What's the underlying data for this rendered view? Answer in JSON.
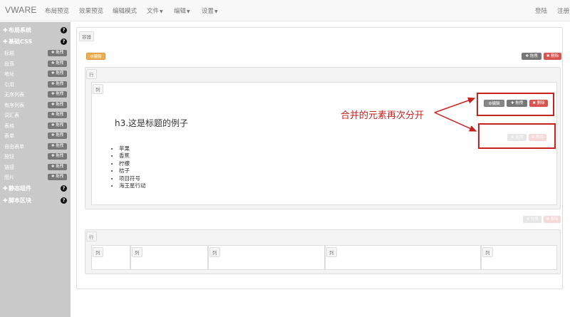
{
  "navbar": {
    "brand": "VWARE",
    "items": [
      "布局预览",
      "效果预览",
      "编辑模式",
      "文件",
      "编辑",
      "设置"
    ],
    "right": [
      "登陆",
      "注册"
    ]
  },
  "sidebar": {
    "sections": [
      "布局系统",
      "基础CSS",
      "静态组件",
      "脚本区块"
    ],
    "items": [
      "标题",
      "段落",
      "地址",
      "引用",
      "无序列表",
      "有序列表",
      "词汇表",
      "表格",
      "表单",
      "自由表单",
      "按钮",
      "链接",
      "图片"
    ],
    "drag_label": "拖拽",
    "help_symbol": "?"
  },
  "canvas": {
    "container_tag": "容器",
    "row_tag": "行",
    "col_tag": "列",
    "edit_label": "编辑",
    "drag_label": "拖拽",
    "delete_label": "删除",
    "heading": "h3.这是标题的例子",
    "list_items": [
      "苹果",
      "香蕉",
      "柠檬",
      "桔子",
      "项目符号",
      "海王星行动"
    ]
  },
  "annotation": {
    "text": "合并的元素再次分开",
    "color": "#c9211e"
  },
  "colors": {
    "sidebar_bg": "#c9c9c9",
    "edit": "#f0ad4e",
    "drag": "#777777",
    "delete": "#d9534f"
  }
}
